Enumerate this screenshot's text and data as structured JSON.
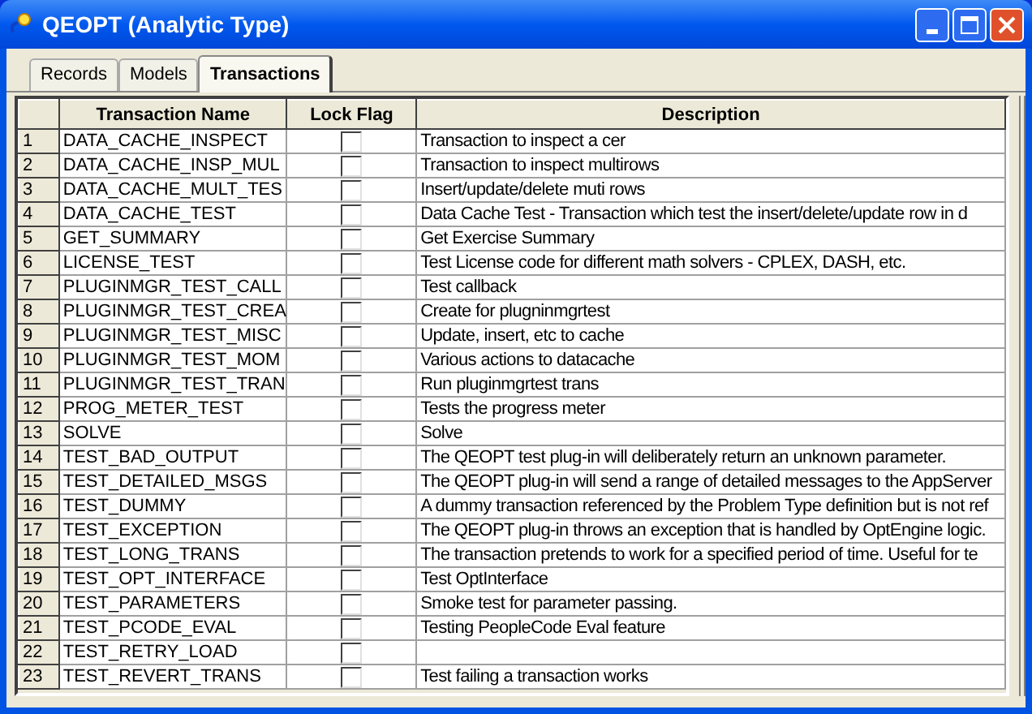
{
  "window": {
    "title": "QEOPT (Analytic Type)"
  },
  "tabs": [
    {
      "label": "Records",
      "selected": false
    },
    {
      "label": "Models",
      "selected": false
    },
    {
      "label": "Transactions",
      "selected": true
    }
  ],
  "table": {
    "columns": [
      "Transaction Name",
      "Lock Flag",
      "Description"
    ],
    "rows": [
      {
        "number": "1",
        "name": "DATA_CACHE_INSPECT",
        "lock_flag": false,
        "description": "Transaction to inspect a cer"
      },
      {
        "number": "2",
        "name": "DATA_CACHE_INSP_MUL",
        "lock_flag": false,
        "description": "Transaction to inspect multirows"
      },
      {
        "number": "3",
        "name": "DATA_CACHE_MULT_TES",
        "lock_flag": false,
        "description": "Insert/update/delete muti rows"
      },
      {
        "number": "4",
        "name": "DATA_CACHE_TEST",
        "lock_flag": false,
        "description": "Data Cache Test - Transaction which test the insert/delete/update row in d"
      },
      {
        "number": "5",
        "name": "GET_SUMMARY",
        "lock_flag": false,
        "description": "Get Exercise Summary"
      },
      {
        "number": "6",
        "name": "LICENSE_TEST",
        "lock_flag": false,
        "description": "Test License code for different math solvers - CPLEX, DASH, etc."
      },
      {
        "number": "7",
        "name": "PLUGINMGR_TEST_CALL",
        "lock_flag": false,
        "description": "Test callback"
      },
      {
        "number": "8",
        "name": "PLUGINMGR_TEST_CREA",
        "lock_flag": false,
        "description": "Create for plugninmgrtest"
      },
      {
        "number": "9",
        "name": "PLUGINMGR_TEST_MISC",
        "lock_flag": false,
        "description": "Update, insert, etc to cache"
      },
      {
        "number": "10",
        "name": "PLUGINMGR_TEST_MOM",
        "lock_flag": false,
        "description": "Various actions to datacache"
      },
      {
        "number": "11",
        "name": "PLUGINMGR_TEST_TRAN",
        "lock_flag": false,
        "description": "Run pluginmgrtest trans"
      },
      {
        "number": "12",
        "name": "PROG_METER_TEST",
        "lock_flag": false,
        "description": "Tests the progress meter"
      },
      {
        "number": "13",
        "name": "SOLVE",
        "lock_flag": false,
        "description": "Solve"
      },
      {
        "number": "14",
        "name": "TEST_BAD_OUTPUT",
        "lock_flag": false,
        "description": "The QEOPT test plug-in will deliberately return an unknown parameter."
      },
      {
        "number": "15",
        "name": "TEST_DETAILED_MSGS",
        "lock_flag": false,
        "description": "The QEOPT plug-in will send a range of detailed messages to the AppServer"
      },
      {
        "number": "16",
        "name": "TEST_DUMMY",
        "lock_flag": false,
        "description": "A dummy transaction referenced by the Problem Type definition but is not ref"
      },
      {
        "number": "17",
        "name": "TEST_EXCEPTION",
        "lock_flag": false,
        "description": "The QEOPT plug-in throws an exception that is handled by OptEngine logic."
      },
      {
        "number": "18",
        "name": "TEST_LONG_TRANS",
        "lock_flag": false,
        "description": "The transaction pretends to work for a specified period of time.  Useful for te"
      },
      {
        "number": "19",
        "name": "TEST_OPT_INTERFACE",
        "lock_flag": false,
        "description": "Test OptInterface"
      },
      {
        "number": "20",
        "name": "TEST_PARAMETERS",
        "lock_flag": false,
        "description": "Smoke test for parameter passing."
      },
      {
        "number": "21",
        "name": "TEST_PCODE_EVAL",
        "lock_flag": false,
        "description": "Testing PeopleCode Eval feature"
      },
      {
        "number": "22",
        "name": "TEST_RETRY_LOAD",
        "lock_flag": false
      },
      {
        "number": "23",
        "name": "TEST_REVERT_TRANS",
        "lock_flag": false,
        "description": "Test failing a transaction works"
      }
    ]
  }
}
